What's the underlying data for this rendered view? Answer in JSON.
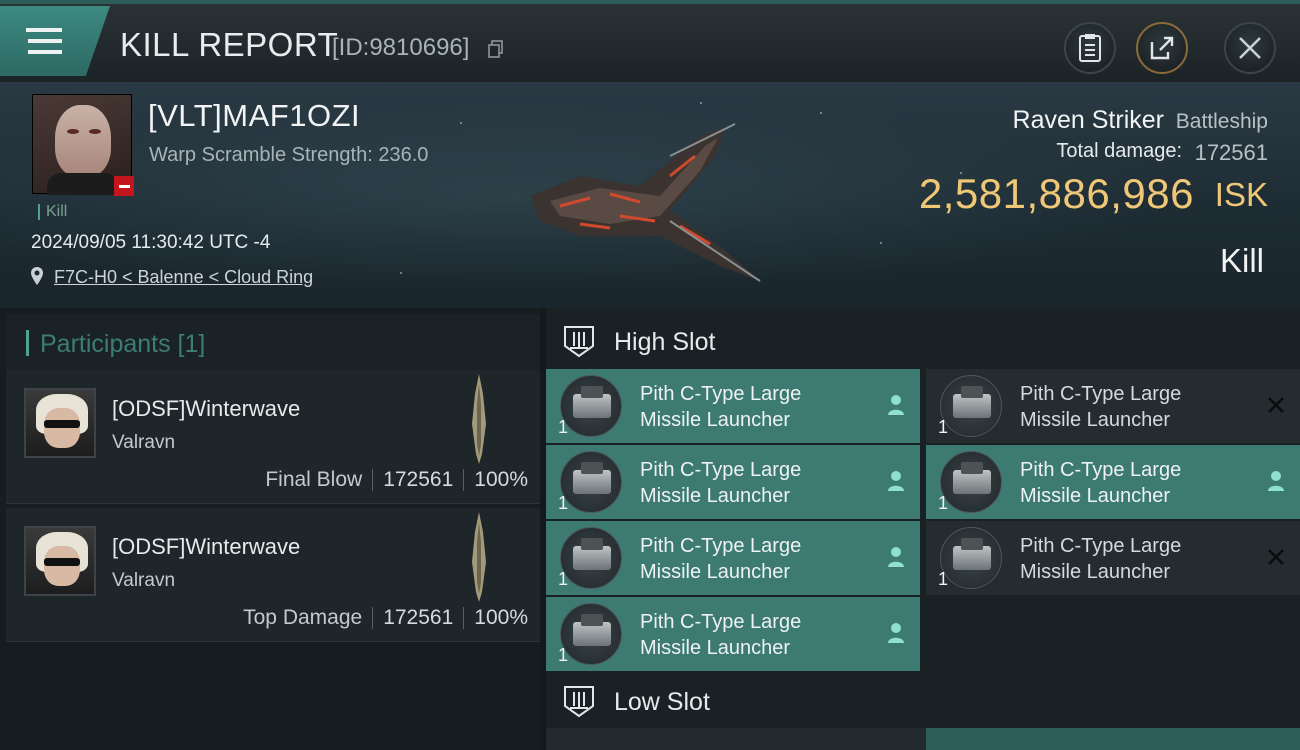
{
  "header": {
    "title": "KILL REPORT",
    "report_id": "[ID:9810696]",
    "icons": [
      "menu-icon",
      "copy-icon",
      "clipboard-icon",
      "share-icon",
      "close-icon"
    ]
  },
  "victim": {
    "name": "[VLT]MAF1OZI",
    "warp_scramble": "Warp Scramble Strength: 236.0",
    "tag": "Kill",
    "datetime": "2024/09/05 11:30:42 UTC -4",
    "location": "F7C-H0 < Balenne < Cloud Ring",
    "ship_name": "Raven Striker",
    "ship_class": "Battleship",
    "total_damage_label": "Total damage:",
    "total_damage": "172561",
    "isk_value": "2,581,886,986",
    "isk_unit": "ISK",
    "result": "Kill"
  },
  "participants": {
    "header": "Participants [1]",
    "items": [
      {
        "name": "[ODSF]Winterwave",
        "ship": "Valravn",
        "role": "Final Blow",
        "damage": "172561",
        "percent": "100%"
      },
      {
        "name": "[ODSF]Winterwave",
        "ship": "Valravn",
        "role": "Top Damage",
        "damage": "172561",
        "percent": "100%"
      }
    ]
  },
  "fitting": {
    "high_slot_label": "High Slot",
    "low_slot_label": "Low Slot",
    "module_line1": "Pith C-Type Large",
    "module_line2": "Missile Launcher",
    "qty": "1"
  },
  "colors": {
    "accent": "#3c7a72",
    "isk": "#f0c777",
    "loss_badge": "#c2161c"
  }
}
